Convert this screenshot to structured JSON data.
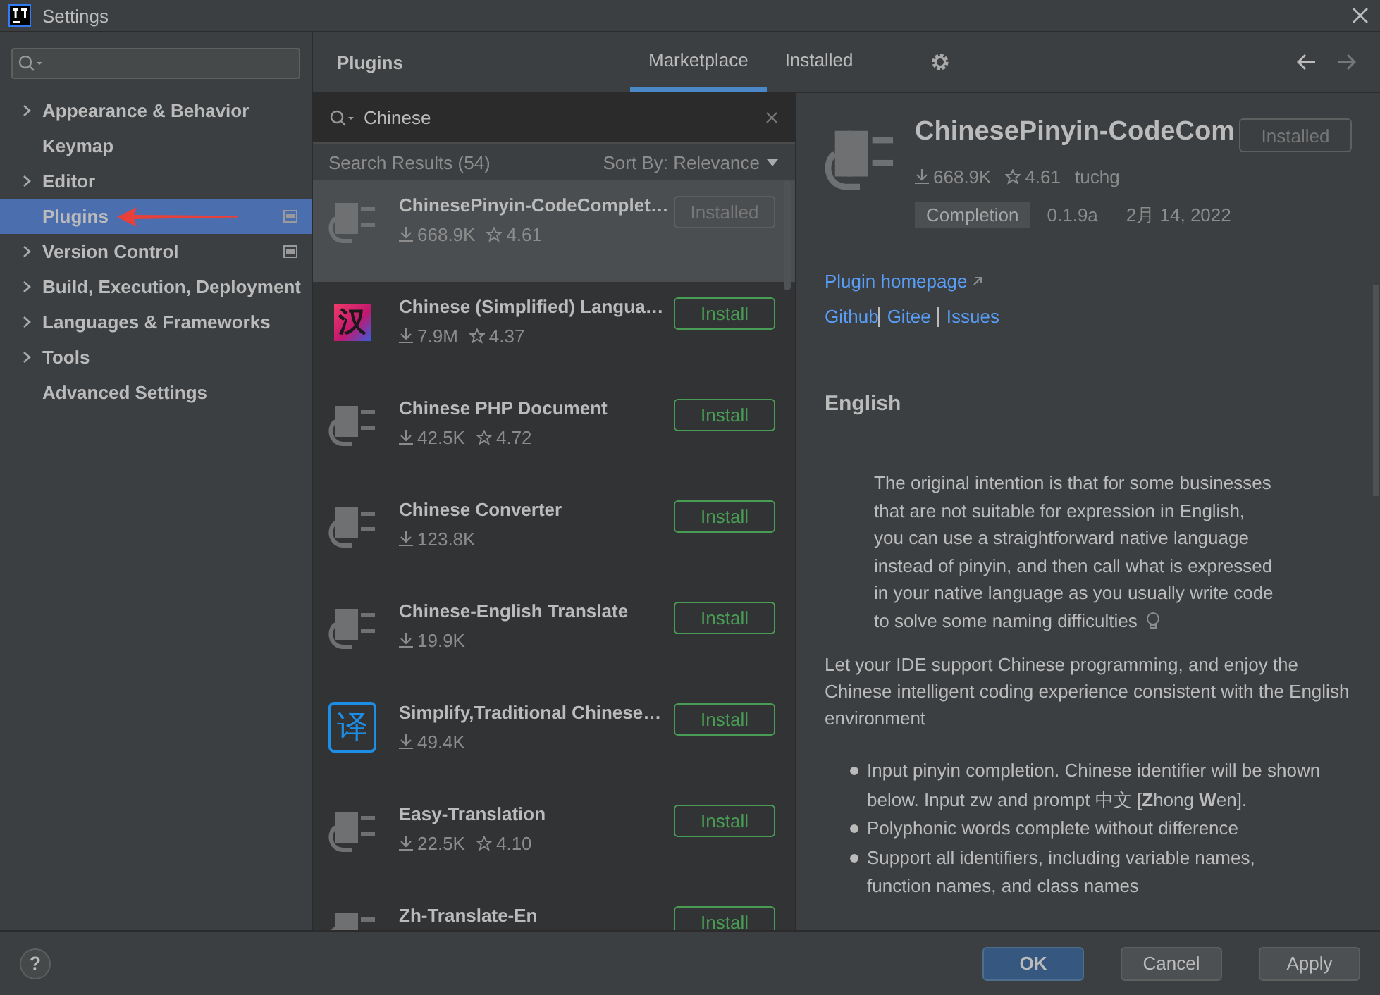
{
  "window": {
    "title": "Settings"
  },
  "sidebar": {
    "items": [
      {
        "label": "Appearance & Behavior",
        "expandable": true,
        "selected": false,
        "badge": false,
        "marked": false
      },
      {
        "label": "Keymap",
        "expandable": false,
        "selected": false,
        "badge": false,
        "marked": false
      },
      {
        "label": "Editor",
        "expandable": true,
        "selected": false,
        "badge": false,
        "marked": false
      },
      {
        "label": "Plugins",
        "expandable": false,
        "selected": true,
        "badge": true,
        "marked": true
      },
      {
        "label": "Version Control",
        "expandable": true,
        "selected": false,
        "badge": true,
        "marked": false
      },
      {
        "label": "Build, Execution, Deployment",
        "expandable": true,
        "selected": false,
        "badge": false,
        "marked": false
      },
      {
        "label": "Languages & Frameworks",
        "expandable": true,
        "selected": false,
        "badge": false,
        "marked": false
      },
      {
        "label": "Tools",
        "expandable": true,
        "selected": false,
        "badge": false,
        "marked": false
      },
      {
        "label": "Advanced Settings",
        "expandable": false,
        "selected": false,
        "badge": false,
        "marked": false
      }
    ]
  },
  "plugins": {
    "title": "Plugins",
    "tabs": [
      {
        "label": "Marketplace",
        "selected": true
      },
      {
        "label": "Installed",
        "selected": false
      }
    ],
    "search": {
      "value": "Chinese"
    },
    "results_label": "Search Results (54)",
    "sort_label": "Sort By: Relevance",
    "list": [
      {
        "name": "ChinesePinyin-CodeComplet…",
        "downloads": "668.9K",
        "rating": "4.61",
        "icon": {
          "kind": "plug"
        },
        "button": "Installed",
        "installed": true,
        "selected": true
      },
      {
        "name": "Chinese (Simplified) Langua…",
        "downloads": "7.9M",
        "rating": "4.37",
        "icon": {
          "kind": "gradient",
          "glyph": "汉"
        },
        "button": "Install",
        "installed": false,
        "selected": false
      },
      {
        "name": "Chinese PHP Document",
        "downloads": "42.5K",
        "rating": "4.72",
        "icon": {
          "kind": "plug"
        },
        "button": "Install",
        "installed": false,
        "selected": false
      },
      {
        "name": "Chinese Converter",
        "downloads": "123.8K",
        "icon": {
          "kind": "plug"
        },
        "button": "Install",
        "installed": false,
        "selected": false
      },
      {
        "name": "Chinese-English Translate",
        "downloads": "19.9K",
        "icon": {
          "kind": "plug"
        },
        "button": "Install",
        "installed": false,
        "selected": false
      },
      {
        "name": "Simplify,Traditional Chinese…",
        "downloads": "49.4K",
        "icon": {
          "kind": "outline",
          "glyph": "译"
        },
        "button": "Install",
        "installed": false,
        "selected": false
      },
      {
        "name": "Easy-Translation",
        "downloads": "22.5K",
        "rating": "4.10",
        "icon": {
          "kind": "plug"
        },
        "button": "Install",
        "installed": false,
        "selected": false
      },
      {
        "name": "Zh-Translate-En",
        "icon": {
          "kind": "plug"
        },
        "button": "Install",
        "installed": false,
        "selected": false
      }
    ]
  },
  "detail": {
    "name": "ChinesePinyin-CodeCom",
    "button": "Installed",
    "installed": true,
    "downloads": "668.9K",
    "rating": "4.61",
    "author": "tuchg",
    "tag": "Completion",
    "version": "0.1.9a",
    "date": "2月 14, 2022",
    "homepage": "Plugin homepage",
    "links": [
      "Github",
      "Gitee",
      "Issues"
    ],
    "heading": "English",
    "quote": [
      "The original intention is that for some businesses",
      "that are not suitable for expression in English,",
      "you can use a straightforward native language",
      "instead of pinyin, and then call what is expressed",
      "in your native language as you usually write code",
      "to solve some naming difficulties"
    ],
    "paragraph": "Let your IDE support Chinese programming, and enjoy the Chinese intelligent coding experience consistent with the English environment",
    "bullets": [
      "Input pinyin completion. Chinese identifier will be shown below. Input zw and prompt 中文 [**Z**hong **W**en].",
      "Polyphonic words complete without difference",
      "Support all identifiers, including variable names, function names, and class names"
    ]
  },
  "footer": {
    "help": "?",
    "buttons": [
      {
        "label": "OK",
        "primary": true
      },
      {
        "label": "Cancel",
        "primary": false
      },
      {
        "label": "Apply",
        "primary": false
      }
    ]
  }
}
